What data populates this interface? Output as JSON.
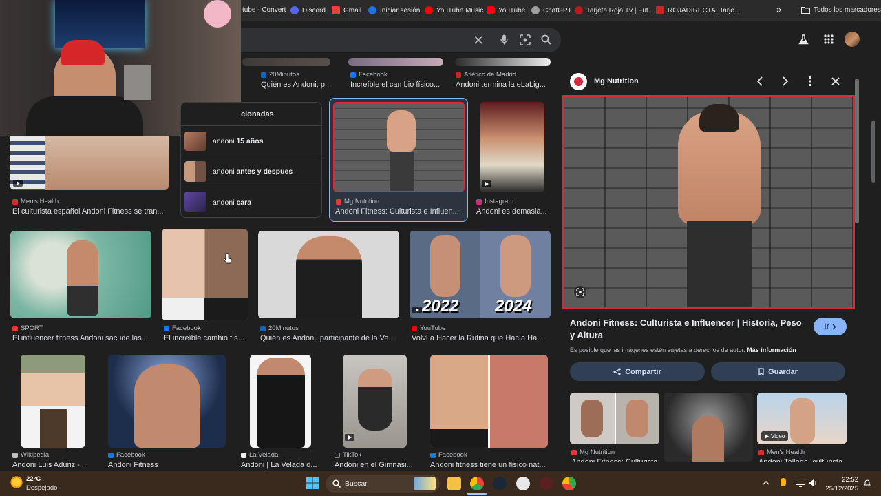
{
  "bookmarks": [
    {
      "label": "tube - Convert",
      "color": "#e53935"
    },
    {
      "label": "Discord",
      "color": "#5865f2"
    },
    {
      "label": "Gmail",
      "color": "#ea4335"
    },
    {
      "label": "Iniciar sesión",
      "color": "#1a73e8"
    },
    {
      "label": "YouTube Music",
      "color": "#ff0000"
    },
    {
      "label": "YouTube",
      "color": "#ff0000"
    },
    {
      "label": "ChatGPT",
      "color": "#9e9e9e"
    },
    {
      "label": "Tarjeta Roja Tv | Fut...",
      "color": "#b71c1c"
    },
    {
      "label": "ROJADIRECTA: Tarje...",
      "color": "#c62828"
    }
  ],
  "bookmarks_more": "»",
  "all_bookmarks": "Todos los marcadores",
  "related": {
    "header": "cionadas",
    "items": [
      {
        "pre": "andoni ",
        "bold": "15 años"
      },
      {
        "pre": "andoni ",
        "bold": "antes y despues"
      },
      {
        "pre": "andoni ",
        "bold": "cara"
      }
    ]
  },
  "grid": {
    "row0": [
      {
        "source": "20Minutos",
        "caption": "Quién es Andoni, p...",
        "fav": "#1565c0"
      },
      {
        "source": "Facebook",
        "caption": "Increíble el cambio físico...",
        "fav": "#1877f2"
      },
      {
        "source": "Atlético de Madrid",
        "caption": "Andoni termina la eLaLig...",
        "fav": "#c62828"
      }
    ],
    "row1": [
      {
        "source": "Men's Health",
        "caption": "El culturista español Andoni Fitness se tran...",
        "fav": "#d32f2f"
      },
      {
        "source": "Mg Nutrition",
        "caption": "Andoni Fitness: Culturista e Influen...",
        "fav": "#e53935"
      },
      {
        "source": "Instagram",
        "caption": "Andoni es demasia...",
        "fav": "#c13584"
      }
    ],
    "row2": [
      {
        "source": "SPORT",
        "caption": "El influencer fitness Andoni sacude las...",
        "fav": "#e53935"
      },
      {
        "source": "Facebook",
        "caption": "El increíble cambio fís...",
        "fav": "#1877f2"
      },
      {
        "source": "20Minutos",
        "caption": "Quién es Andoni, participante de la Ve...",
        "fav": "#1565c0"
      },
      {
        "source": "YouTube",
        "caption": "Volví a Hacer la Rutina que Hacía Ha...",
        "fav": "#ff0000"
      }
    ],
    "row3": [
      {
        "source": "Wikipedia",
        "caption": "Andoni Luis Aduriz - ...",
        "fav": "#bdbdbd"
      },
      {
        "source": "Facebook",
        "caption": "Andoni Fitness",
        "fav": "#1877f2"
      },
      {
        "source": "La Velada",
        "caption": "Andoni | La Velada d...",
        "fav": "#eeeeee"
      },
      {
        "source": "TikTok",
        "caption": "Andoni en el Gimnasi...",
        "fav": "#212121"
      },
      {
        "source": "Facebook",
        "caption": "Andoni fitness tiene un físico nat...",
        "fav": "#1877f2"
      }
    ]
  },
  "thumb_text": {
    "year_left": "2022",
    "year_right": "2024"
  },
  "panel": {
    "site": "Mg Nutrition",
    "title": "Andoni Fitness: Culturista e Influencer | Historia, Peso y Altura",
    "go_label": "Ir",
    "rights_text": "Es posible que las imágenes estén sujetas a derechos de autor.",
    "more_info": "Más información",
    "share_label": "Compartir",
    "save_label": "Guardar",
    "related": [
      {
        "source": "Mg Nutrition",
        "caption": "Andoni Fitness: Culturista e...",
        "fav": "#e53935"
      },
      {
        "source": "",
        "caption": "",
        "fav": ""
      },
      {
        "source": "Men's Health",
        "caption": "Andoni Tallada, culturista...",
        "fav": "#d32f2f",
        "badge": "Video"
      }
    ]
  },
  "taskbar": {
    "temp": "22°C",
    "weather": "Despejado",
    "search_placeholder": "Buscar",
    "time": "22:52",
    "date": "25/12/2025"
  },
  "colors": {
    "accent_red": "#e0263a",
    "selected_border": "#8ab4f8"
  }
}
